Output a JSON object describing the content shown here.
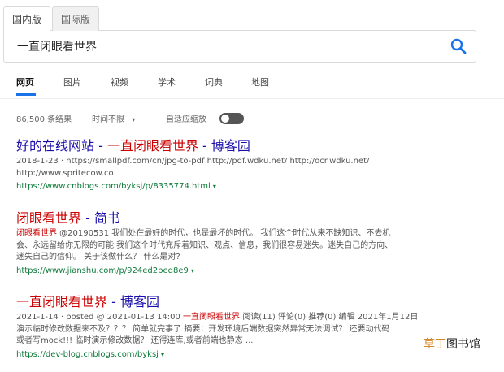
{
  "region_tabs": [
    {
      "label": "国内版",
      "active": true
    },
    {
      "label": "国际版",
      "active": false
    }
  ],
  "search": {
    "query": "一直闭眼看世界",
    "icon": "search-icon"
  },
  "nav": {
    "items": [
      "网页",
      "图片",
      "视频",
      "学术",
      "词典",
      "地图"
    ],
    "active_index": 0
  },
  "filters": {
    "result_count": "86,500 条结果",
    "time_filter": "时间不限",
    "time_caret": "▾",
    "adaptive_zoom": "自适应缩放",
    "adaptive_zoom_on": true
  },
  "results": [
    {
      "title_pre": "好的在线网站 - ",
      "title_hl": "一直闭眼看世界",
      "title_post": " - 博客园",
      "desc": [
        {
          "t": "2018-1-23 · https://smallpdf.com/cn/jpg-to-pdf http://pdf.wdku.net/ http://ocr.wdku.net/",
          "hl": false
        },
        {
          "t": "http://www.spritecow.co",
          "hl": false
        }
      ],
      "url": "https://www.cnblogs.com/byksj/p/8335774.html"
    },
    {
      "title_pre": "",
      "title_hl": "闭眼看世界",
      "title_post": " - 简书",
      "desc_hl": "闭眼看世界",
      "desc_line1_rest": " @20190531 我们处在最好的时代，也是最坏的时代。 我们这个时代从来不缺知识、不去机",
      "desc_line2": "会、永远留给你无限的可能 我们这个时代充斥着知识、观点、信息，我们很容易迷失。迷失自己的方向、",
      "desc_line3": "迷失自己的信仰。 关于该做什么？ 什么是对?",
      "url": "https://www.jianshu.com/p/924ed2bed8e9"
    },
    {
      "title_pre": "",
      "title_hl": "一直闭眼看世界",
      "title_post": " - 博客园",
      "desc_line1_pre": "2021-1-14 · posted @ 2021-01-13 14:00 ",
      "desc_line1_hl": "一直闭眼看世界",
      "desc_line1_post": " 阅读(11) 评论(0) 推荐(0) 编辑 2021年1月12日",
      "desc_line2": "演示临时修改数据来不及？？？ 简单就完事了 摘要：开发环境后端数据突然异常无法调试？ 还要动代码",
      "desc_line3": "或者写mock!!! 临时演示修改数据？ 还得连库,或者前端也静态 ...",
      "url": "https://dev-blog.cnblogs.com/byksj"
    }
  ],
  "url_caret": "▾",
  "watermark": {
    "accent": "草丁",
    "rest": "图书馆"
  },
  "colors": {
    "link": "#1a0dab",
    "highlight": "#cc0000",
    "url": "#0f7a3a",
    "accent": "#1a73e8",
    "search_icon": "#1a73e8"
  }
}
